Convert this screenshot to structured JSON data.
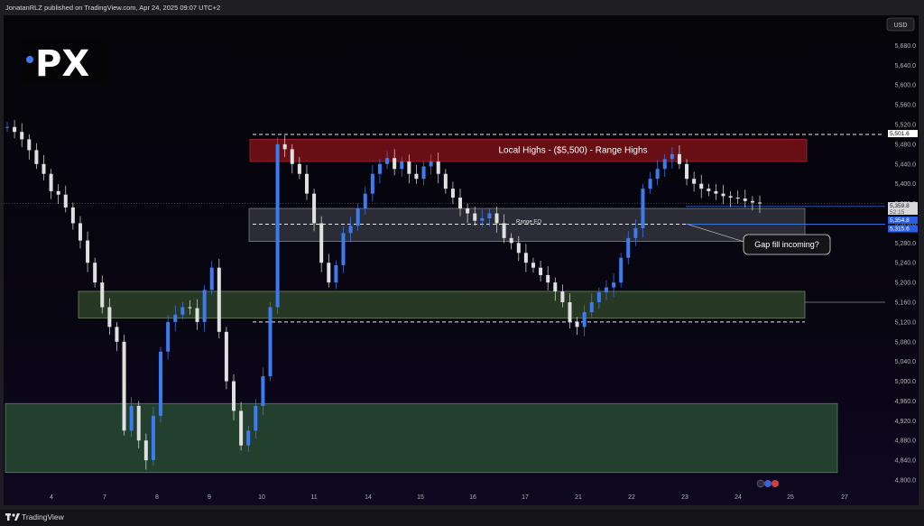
{
  "header": {
    "publisher": "JonatanRLZ published on TradingView.com, Apr 24, 2025 09:07 UTC+2"
  },
  "logo": {
    "text": "PX"
  },
  "currency_button": "USD",
  "footer": {
    "brand": "TradingView"
  },
  "colors": {
    "up": "#3d7cf0",
    "down": "#e0e0e0",
    "resistance_zone": "#7a1018",
    "equilibrium_zone": "#3a3a44",
    "support_zone": "#35502c",
    "demand_zone": "#284a32"
  },
  "icons": [
    "tradingview-logo-icon",
    "flag-badge-icon"
  ],
  "chart_data": {
    "type": "candlestick",
    "title": "",
    "y_ticks": [
      5680,
      5640,
      5600,
      5560,
      5520,
      5480,
      5440,
      5400,
      5360,
      5320,
      5280,
      5240,
      5200,
      5160,
      5120,
      5080,
      5040,
      5000,
      4960,
      4920,
      4880,
      4840,
      4800
    ],
    "y_tick_labels": [
      "5,680.0",
      "5,640.0",
      "5,600.0",
      "5,560.0",
      "5,520.0",
      "5,480.0",
      "5,440.0",
      "5,400.0",
      "5,360.0",
      "5,320.0",
      "5,280.0",
      "5,240.0",
      "5,200.0",
      "5,160.0",
      "5,120.0",
      "5,080.0",
      "5,040.0",
      "5,000.0",
      "4,960.0",
      "4,920.0",
      "4,880.0",
      "4,840.0",
      "4,800.0"
    ],
    "ylim": [
      4780,
      5720
    ],
    "x_ticks": [
      "4",
      "7",
      "8",
      "9",
      "10",
      "11",
      "14",
      "15",
      "16",
      "17",
      "21",
      "22",
      "23",
      "24",
      "25",
      "27"
    ],
    "price_badges": [
      {
        "value": 5501.6,
        "label": "5,501.6",
        "style": "white"
      },
      {
        "value": 5359.8,
        "label": "5,359.8",
        "sub": "52:15",
        "style": "gray"
      },
      {
        "value": 5354.8,
        "label": "5,354.8",
        "style": "blue"
      },
      {
        "value": 5315.6,
        "label": "5,315.6",
        "style": "blue"
      }
    ],
    "zones": [
      {
        "name": "local-highs-zone",
        "label": "Local Highs - ($5,500) - Range Highs",
        "from": 5445,
        "to": 5490,
        "x_start": "10",
        "x_end": "25"
      },
      {
        "name": "range-eq-zone",
        "label": "Range EQ",
        "from": 5283,
        "to": 5350,
        "x_start": "10",
        "x_end": "25"
      },
      {
        "name": "support-zone",
        "label": "",
        "from": 5128,
        "to": 5182,
        "x_start": "7",
        "x_end": "25"
      },
      {
        "name": "demand-zone",
        "label": "",
        "from": 4815,
        "to": 4955,
        "x_start": "4",
        "x_end": "27"
      }
    ],
    "levels": [
      {
        "value": 5500,
        "style": "dashed"
      },
      {
        "value": 5318,
        "style": "dashed"
      },
      {
        "value": 5120,
        "style": "dashed"
      }
    ],
    "annotation": {
      "text": "Gap fill incoming?",
      "target": 5318
    },
    "series_close": [
      5515,
      5505,
      5490,
      5468,
      5440,
      5420,
      5385,
      5378,
      5352,
      5320,
      5285,
      5240,
      5200,
      5150,
      5110,
      5080,
      4900,
      4950,
      4880,
      4840,
      4930,
      5060,
      5120,
      5135,
      5150,
      5148,
      5120,
      5185,
      5230,
      5100,
      5000,
      4940,
      4870,
      4900,
      4950,
      5010,
      5150,
      5480,
      5470,
      5440,
      5420,
      5380,
      5320,
      5240,
      5200,
      5235,
      5300,
      5315,
      5350,
      5380,
      5420,
      5440,
      5452,
      5430,
      5445,
      5420,
      5410,
      5435,
      5445,
      5420,
      5390,
      5372,
      5350,
      5340,
      5325,
      5330,
      5340,
      5320,
      5290,
      5280,
      5260,
      5240,
      5230,
      5215,
      5200,
      5182,
      5160,
      5120,
      5110,
      5140,
      5160,
      5180,
      5190,
      5200,
      5250,
      5290,
      5310,
      5390,
      5410,
      5430,
      5450,
      5460,
      5440,
      5410,
      5400,
      5390,
      5385,
      5380,
      5375,
      5372,
      5370,
      5365,
      5362,
      5360
    ]
  }
}
